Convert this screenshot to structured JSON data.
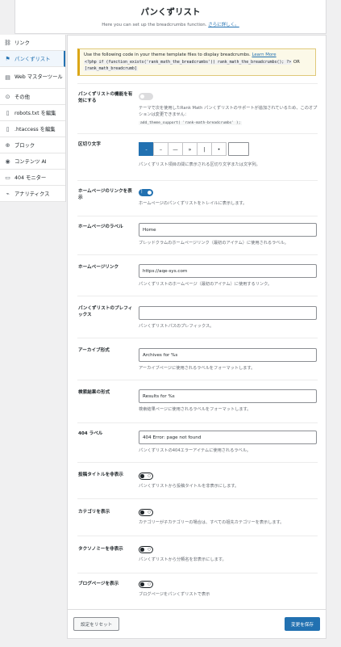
{
  "header": {
    "title": "パンくずリスト",
    "subtitle": "Here you can set up the breadcrumbs function.",
    "learn_more": "さらに詳しく。"
  },
  "sidebar": {
    "items": [
      {
        "label": "リンク",
        "icon": "link-icon",
        "glyph": "⛓"
      },
      {
        "label": "パンくずリスト",
        "icon": "signpost-icon",
        "glyph": "⚑"
      },
      {
        "label": "Web マスターツール",
        "icon": "toolbox-icon",
        "glyph": "▤"
      },
      {
        "label": "その他",
        "icon": "settings-circle-icon",
        "glyph": "⊙"
      },
      {
        "label": "robots.txt を編集",
        "icon": "file-icon",
        "glyph": "▯"
      },
      {
        "label": ".htaccess を編集",
        "icon": "file-code-icon",
        "glyph": "▯"
      },
      {
        "label": "ブロック",
        "icon": "block-icon",
        "glyph": "⊕"
      },
      {
        "label": "コンテンツ AI",
        "icon": "content-ai-icon",
        "glyph": "◉"
      },
      {
        "label": "404 モニター",
        "icon": "monitor-icon",
        "glyph": "▭"
      },
      {
        "label": "アナリティクス",
        "icon": "analytics-icon",
        "glyph": "⌁"
      }
    ]
  },
  "notice": {
    "text": "Use the following code in your theme template files to display breadcrumbs.",
    "link": "Learn More",
    "code1": "<?php if (function_exists('rank_math_the_breadcrumbs')) rank_math_the_breadcrumbs(); ?>",
    "or": "OR",
    "code2": "[rank_math_breadcrumb]"
  },
  "settings": {
    "enable": {
      "label": "パンくずリストの機能を有効にする",
      "desc": "テーマで次を使用したRank Math パンくずリストのサポートが追加されているため、このオプションは変更できません：",
      "code": "add_theme_support( 'rank-math-breadcrumbs' );"
    },
    "separator": {
      "label": "区切り文字",
      "options": [
        "-",
        "–",
        "—",
        "»",
        "|",
        "•"
      ],
      "desc": "パンくずリスト項目の間に表示される区切り文字または文字列。"
    },
    "show_home": {
      "label": "ホームページのリンクを表示",
      "desc": "ホームページのパンくずリストをトレイルに表示します。"
    },
    "home_label": {
      "label": "ホームページのラベル",
      "value": "Home",
      "desc": "ブレッドクラムのホームページリンク（最初のアイテム）に使用されるラベル。"
    },
    "home_link": {
      "label": "ホームページリンク",
      "value": "https://aqe-sys.com",
      "desc": "パンくずリストのホームページ（最初のアイテム）に使用するリンク。"
    },
    "prefix": {
      "label": "パンくずリストのプレフィックス",
      "value": "",
      "desc": "パンくずリストパスのプレフィックス。"
    },
    "archive": {
      "label": "アーカイブ形式",
      "value": "Archives for %s",
      "desc": "アーカイブページに使用されるラベルをフォーマットします。"
    },
    "search": {
      "label": "検索結果の形式",
      "value": "Results for %s",
      "desc": "検索結果ページに使用されるラベルをフォーマットします。"
    },
    "label404": {
      "label": "404 ラベル",
      "value": "404 Error: page not found",
      "desc": "パンくずリストの404エラーアイテムに使用されるラベル。"
    },
    "hide_title": {
      "label": "投稿タイトルを非表示",
      "desc": "パンくずリストから投稿タイトルを非表示にします。"
    },
    "show_category": {
      "label": "カテゴリを表示",
      "desc": "カテゴリーが子カテゴリーの場合は、すべての祖先カテゴリーを表示します。"
    },
    "hide_taxonomy": {
      "label": "タクソノミーを非表示",
      "desc": "パンくずリストから分類名を非表示にします。"
    },
    "blog_page": {
      "label": "ブログページを表示",
      "desc": "ブログページをパンくずリストで表示"
    }
  },
  "footer": {
    "reset": "設定をリセット",
    "save": "変更を保存"
  }
}
